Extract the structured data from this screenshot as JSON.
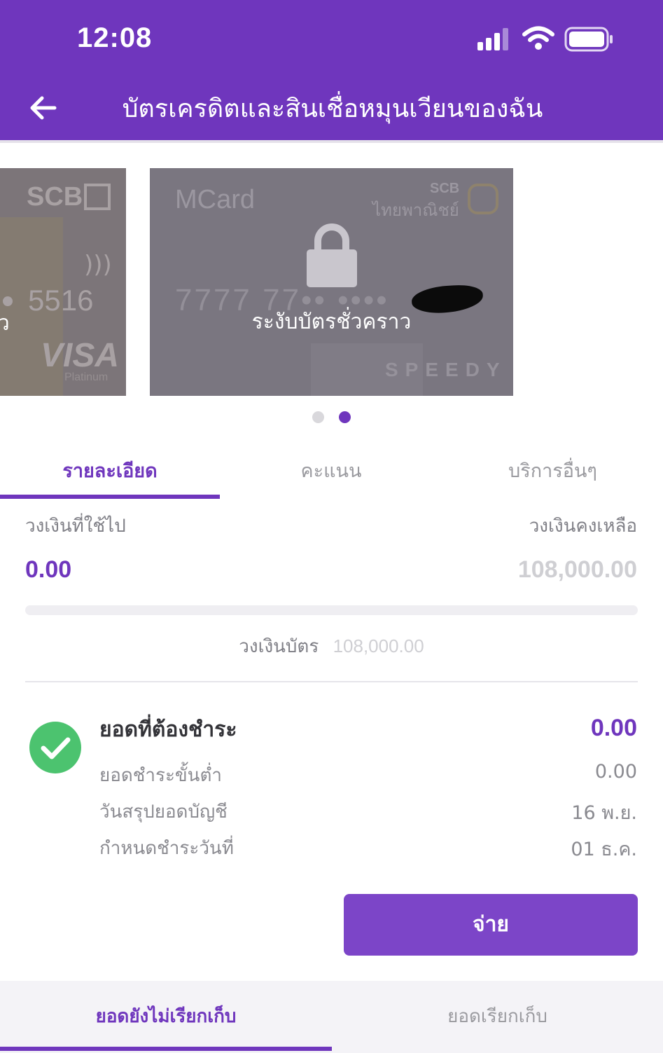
{
  "status_bar": {
    "time": "12:08"
  },
  "header": {
    "title": "บัตรเครดิตและสินเชื่อหมุนเวียนของฉัน",
    "back_icon": "arrow-left-icon"
  },
  "cards": [
    {
      "brand": "SCB",
      "number_tail": "5516",
      "network": "VISA",
      "tier": "Platinum",
      "status_text_partial": "าว"
    },
    {
      "product": "MCard",
      "bank_short": "SCB",
      "bank_name": "ไทยพาณิชย์",
      "number": "7777 77•• •••• ",
      "series": "SPEEDY",
      "status_text": "ระงับบัตรชั่วคราว",
      "lock_icon": "lock-icon"
    }
  ],
  "pager": {
    "count": 2,
    "active": 2
  },
  "tabs": {
    "details": "รายละเอียด",
    "points": "คะแนน",
    "other": "บริการอื่นๆ",
    "active": "details"
  },
  "credit": {
    "used_label": "วงเงินที่ใช้ไป",
    "used_value": "0.00",
    "remaining_label": "วงเงินคงเหลือ",
    "remaining_value": "108,000.00",
    "usage_fraction": 0,
    "limit_label": "วงเงินบัตร",
    "limit_value": "108,000.00"
  },
  "payment": {
    "status_icon": "check-circle-icon",
    "due_label": "ยอดที่ต้องชำระ",
    "due_amount": "0.00",
    "min_label": "ยอดชำระขั้นต่ำ",
    "min_value": "0.00",
    "statement_label": "วันสรุปยอดบัญชี",
    "statement_value": "16 พ.ย.",
    "due_date_label": "กำหนดชำระวันที่",
    "due_date_value": "01 ธ.ค.",
    "pay_button": "จ่าย"
  },
  "bottom_tabs": {
    "unbilled": "ยอดยังไม่เรียกเก็บ",
    "billed": "ยอดเรียกเก็บ",
    "active": "unbilled"
  },
  "colors": {
    "brand": "#6f36bd",
    "button": "#7c45c8",
    "success": "#4cc36f"
  }
}
